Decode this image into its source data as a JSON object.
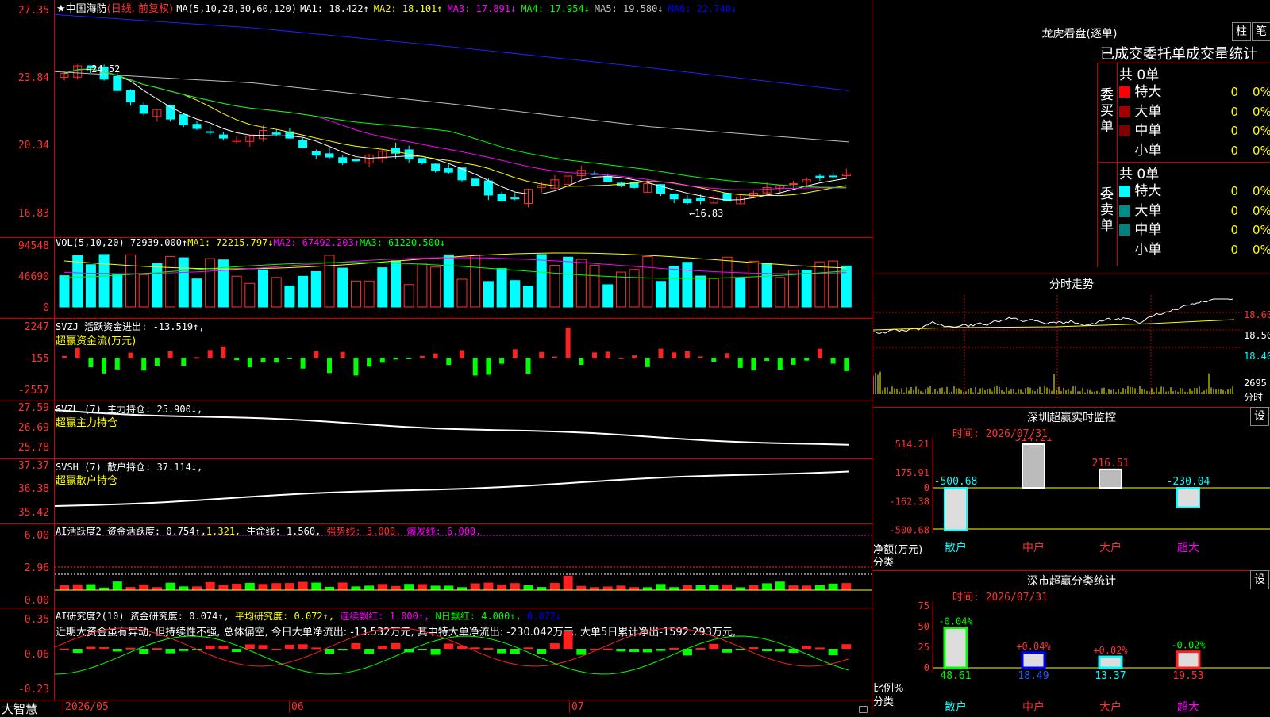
{
  "stock": {
    "star": "★",
    "name": "中国海防",
    "period": "(日线, 前复权)"
  },
  "ma": {
    "params": "MA(5,10,20,30,60,120)",
    "items": [
      {
        "label": "MA1:",
        "value": "18.422↑",
        "color": "#ffffff"
      },
      {
        "label": "MA2:",
        "value": "18.101↑",
        "color": "#ffff00"
      },
      {
        "label": "MA3:",
        "value": "17.891↓",
        "color": "#ff00ff"
      },
      {
        "label": "MA4:",
        "value": "17.954↓",
        "color": "#00ff00"
      },
      {
        "label": "MA5:",
        "value": "19.580↓",
        "color": "#c0c0c0"
      },
      {
        "label": "MA6:",
        "value": "22.740↓",
        "color": "#0000ff"
      }
    ]
  },
  "price_axis": [
    "27.35",
    "23.84",
    "20.34",
    "16.83"
  ],
  "price_marks": {
    "high": "24.52",
    "low": "16.83"
  },
  "vol": {
    "header": "VOL(5,10,20)",
    "value": "72939.000↑",
    "ma1": "MA1: 72215.797↓",
    "ma2": "MA2: 67492.203↑",
    "ma3": "MA3: 61220.500↓",
    "axis": [
      "94548",
      "46690",
      "0"
    ]
  },
  "svzj": {
    "header": "SVZJ  活跃资金进出: -13.519↑,",
    "sub": "超赢资金流(万元)",
    "axis": [
      "2247",
      "-155",
      "-2557"
    ]
  },
  "svzl": {
    "header": "SVZL (7) 主力持仓: 25.900↓,",
    "sub": "超赢主力持仓",
    "axis": [
      "27.59",
      "26.69",
      "25.78"
    ]
  },
  "svsh": {
    "header": "SVSH (7) 散户持仓: 37.114↓,",
    "sub": "超赢散户持仓",
    "axis": [
      "37.37",
      "36.38",
      "35.42"
    ]
  },
  "ai1": {
    "p1": "AI活跃度2 资金活跃度: 0.754↑,",
    "p2": "1.321,",
    "p3": " 生命线: 1.560,",
    "p4": " 强势线: 3.000,",
    "p5": " 爆发线: 6.000,",
    "axis": [
      "6.00",
      "2.96",
      "0.00"
    ]
  },
  "ai2": {
    "p1": "AI研究度2(10) 资金研究度: 0.074↑,",
    "p2": " 平均研究度: 0.072↑,",
    "p3": " 连续飘红: 1.000↑,",
    "p4": " N日飘红: 4.000↑,",
    "p5": " 0.072↓",
    "text": "近期大资金虽有异动, 但持续性不强, 总体偏空, 今日大单净流出: -13.532万元, 其中特大单净流出: -230.042万元, 大单5日累计净出-1592.293万元,",
    "axis": [
      "0.35",
      "0.06",
      "-0.23"
    ]
  },
  "xaxis": {
    "brand": "大智慧",
    "labels": [
      "2026/05",
      "06",
      "07"
    ]
  },
  "dragon": {
    "title": "龙虎看盘(逐单)",
    "btn1": "柱",
    "btn2": "笔",
    "subtitle": "已成交委托单成交量统计",
    "buy": {
      "label": "委买单",
      "total": "共 0单",
      "rows": [
        {
          "name": "特大",
          "v": "0",
          "p": "0%",
          "c": "#ff0000"
        },
        {
          "name": "大单",
          "v": "0",
          "p": "0%",
          "c": "#a00000"
        },
        {
          "name": "中单",
          "v": "0",
          "p": "0%",
          "c": "#800000"
        },
        {
          "name": "小单",
          "v": "0",
          "p": "0%",
          "c": "#000000"
        }
      ]
    },
    "sell": {
      "label": "委卖单",
      "total": "共 0单",
      "rows": [
        {
          "name": "特大",
          "v": "0",
          "p": "0%",
          "c": "#00ffff"
        },
        {
          "name": "大单",
          "v": "0",
          "p": "0%",
          "c": "#008b8b"
        },
        {
          "name": "中单",
          "v": "0",
          "p": "0%",
          "c": "#008080"
        },
        {
          "name": "小单",
          "v": "0",
          "p": "0%",
          "c": "#000000"
        }
      ]
    }
  },
  "intraday": {
    "title": "分时走势",
    "axis": [
      "18.60",
      "18.50",
      "18.40"
    ],
    "vol": "2695",
    "unit": "分时"
  },
  "sz_monitor": {
    "title": "深圳超赢实时监控",
    "btn": "设",
    "time": "时间: 2026/07/31",
    "axis": [
      "514.21",
      "175.91",
      "0",
      "-162.38",
      "-500.68"
    ],
    "ylabel1": "净额(万元)",
    "ylabel2": "分类",
    "chart_data": {
      "type": "bar",
      "categories": [
        "散户",
        "中户",
        "大户",
        "超大"
      ],
      "values": [
        -500.68,
        514.21,
        216.51,
        -230.04
      ],
      "ylim": [
        -500.68,
        514.21
      ]
    }
  },
  "sz_class": {
    "title": "深市超赢分类统计",
    "btn": "设",
    "time": "时间: 2026/07/31",
    "axis": [
      "75",
      "50",
      "25",
      "0"
    ],
    "ylabel1": "比例%",
    "ylabel2": "分类",
    "chart_data": {
      "type": "bar",
      "categories": [
        "散户",
        "中户",
        "大户",
        "超大"
      ],
      "values": [
        48.61,
        18.49,
        13.37,
        19.53
      ],
      "changes": [
        "-0.04%",
        "+0.04%",
        "+0.02%",
        "-0.02%"
      ],
      "ylim": [
        0,
        75
      ]
    }
  }
}
